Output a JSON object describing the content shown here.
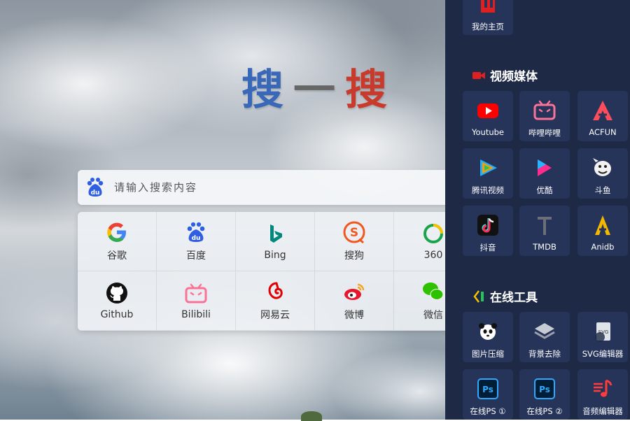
{
  "title": {
    "part1": "搜",
    "part2": "一",
    "part3": "搜"
  },
  "search": {
    "placeholder": "请输入搜索内容",
    "engine": "baidu-icon"
  },
  "engines": [
    {
      "label": "谷歌",
      "icon": "google-icon"
    },
    {
      "label": "百度",
      "icon": "baidu-icon"
    },
    {
      "label": "Bing",
      "icon": "bing-icon"
    },
    {
      "label": "搜狗",
      "icon": "sogou-icon"
    },
    {
      "label": "360",
      "icon": "360-icon"
    },
    {
      "label": "Github",
      "icon": "github-icon"
    },
    {
      "label": "Bilibili",
      "icon": "bilibili-icon"
    },
    {
      "label": "网易云",
      "icon": "netease-music-icon"
    },
    {
      "label": "微博",
      "icon": "weibo-icon"
    },
    {
      "label": "微信",
      "icon": "wechat-icon"
    }
  ],
  "panel": {
    "top_item": {
      "label": "我的主页",
      "icon": "home-icon"
    },
    "sections": [
      {
        "title": "视频媒体",
        "icon": "video-camera-icon",
        "items": [
          {
            "label": "Youtube",
            "icon": "youtube-icon"
          },
          {
            "label": "哔哩哔哩",
            "icon": "bilibili-icon"
          },
          {
            "label": "ACFUN",
            "icon": "acfun-icon"
          },
          {
            "label": "腾讯视频",
            "icon": "tencent-video-icon"
          },
          {
            "label": "优酷",
            "icon": "youku-icon"
          },
          {
            "label": "斗鱼",
            "icon": "douyu-icon"
          },
          {
            "label": "抖音",
            "icon": "tiktok-icon"
          },
          {
            "label": "TMDB",
            "icon": "tmdb-icon"
          },
          {
            "label": "Anidb",
            "icon": "anidb-icon"
          }
        ]
      },
      {
        "title": "在线工具",
        "icon": "tools-icon",
        "items": [
          {
            "label": "图片压缩",
            "icon": "panda-icon"
          },
          {
            "label": "背景去除",
            "icon": "layers-icon"
          },
          {
            "label": "SVG编辑器",
            "icon": "svg-file-icon"
          },
          {
            "label": "在线PS ①",
            "icon": "photoshop-icon"
          },
          {
            "label": "在线PS ②",
            "icon": "photoshop-icon"
          },
          {
            "label": "音频编辑器",
            "icon": "music-note-icon"
          }
        ]
      }
    ]
  },
  "colors": {
    "panel_bg": "#1e2a45",
    "tile_bg": "#26345a",
    "title_blue": "#3a68b8",
    "title_gray": "#666666",
    "title_red": "#c83a2c"
  }
}
